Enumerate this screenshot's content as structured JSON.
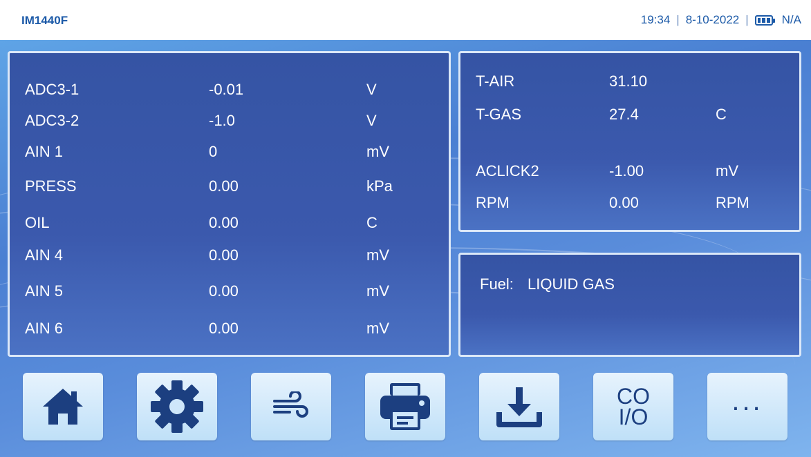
{
  "header": {
    "device_name": "IM1440F",
    "time": "19:34",
    "separator": "|",
    "date": "8-10-2022",
    "battery_status": "N/A",
    "battery_icon": "battery-full-icon"
  },
  "left_panel": {
    "rows": [
      {
        "label": "ADC3-1",
        "value": "-0.01",
        "unit": "V"
      },
      {
        "label": "ADC3-2",
        "value": "-1.0",
        "unit": "V"
      },
      {
        "label": "AIN 1",
        "value": "0",
        "unit": "mV"
      },
      {
        "label": "PRESS",
        "value": "0.00",
        "unit": "kPa"
      },
      {
        "label": "OIL",
        "value": "0.00",
        "unit": "C"
      },
      {
        "label": "AIN 4",
        "value": "0.00",
        "unit": "mV"
      },
      {
        "label": "AIN 5",
        "value": "0.00",
        "unit": "mV"
      },
      {
        "label": "AIN 6",
        "value": "0.00",
        "unit": "mV"
      }
    ]
  },
  "right_panel": {
    "rows": [
      {
        "label": "T-AIR",
        "value": "31.10",
        "unit": ""
      },
      {
        "label": "T-GAS",
        "value": "27.4",
        "unit": "C"
      },
      {
        "label": "ACLICK2",
        "value": "-1.00",
        "unit": "mV"
      },
      {
        "label": "RPM",
        "value": "0.00",
        "unit": "RPM"
      }
    ]
  },
  "fuel_panel": {
    "label": "Fuel:",
    "value": "LIQUID GAS"
  },
  "toolbar": {
    "home_icon": "home-icon",
    "settings_icon": "gear-icon",
    "air_icon": "wind-icon",
    "print_icon": "printer-icon",
    "download_icon": "download-icon",
    "co_line1": "CO",
    "co_line2": "I/O",
    "more_label": "..."
  },
  "colors": {
    "header_text": "#1c5aa8",
    "panel_bg": "#3554a4",
    "panel_border": "#dbe8f8",
    "button_bg": "#d5eafb",
    "icon_color": "#1c3f80"
  }
}
